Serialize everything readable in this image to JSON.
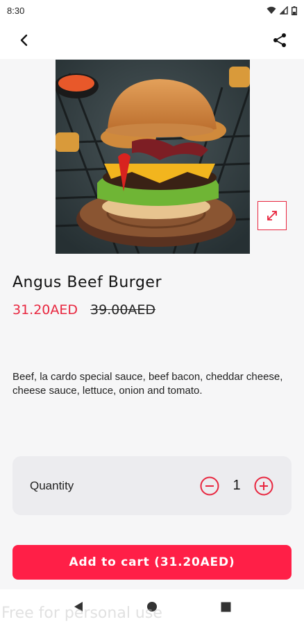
{
  "status_bar": {
    "time": "8:30",
    "icons": [
      "wifi-icon",
      "signal-icon",
      "battery-icon"
    ]
  },
  "app_bar": {
    "back_icon": "chevron-left-icon",
    "share_icon": "share-icon"
  },
  "product": {
    "image_alt": "Angus Beef Burger",
    "title": "Angus Beef Burger",
    "price_current": "31.20AED",
    "price_original": "39.00AED",
    "description": "Beef, la cardo special sauce, beef bacon, cheddar cheese, cheese sauce, lettuce, onion and tomato."
  },
  "quantity": {
    "label": "Quantity",
    "value": "1",
    "decrement_icon": "minus-circle-icon",
    "increment_icon": "plus-circle-icon"
  },
  "add_to_cart": {
    "label": "Add to cart (31.20AED)"
  },
  "nav_bar": {
    "icons": [
      "back-triangle-icon",
      "home-circle-icon",
      "recents-square-icon"
    ]
  },
  "watermark": "Free for personal use",
  "colors": {
    "accent": "#ff1f47",
    "price": "#e8253e",
    "background": "#f6f6f7",
    "card": "#ececef"
  }
}
